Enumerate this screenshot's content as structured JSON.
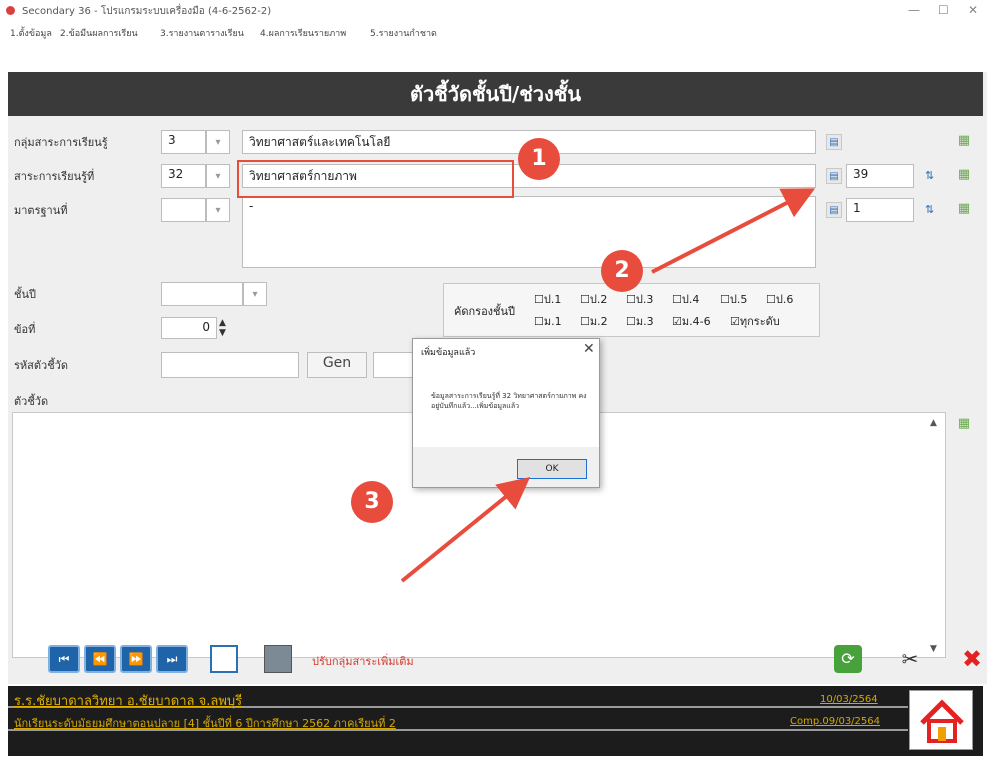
{
  "window": {
    "title": "Secondary 36 - โปรแกรมระบบเครื่องมือ (4-6-2562-2)"
  },
  "menu": [
    "1.ตั้งข้อมูล",
    "2.ข้อมืนผลการเรียน",
    "3.รายงานตารางเรียน",
    "4.ผลการเรียนรายภาพ",
    "5.รายงานกำชาด"
  ],
  "header": {
    "title": "ตัวชี้วัดชั้นปี/ช่วงชั้น"
  },
  "labels": {
    "subject_group": "กลุ่มสาระการเรียนรู้",
    "strand": "สาระการเรียนรู้ที่",
    "standard": "มาตรฐานที่",
    "grade": "ชั้นปี",
    "item_no": "ข้อที่",
    "indicator_code": "รหัสตัวชี้วัด",
    "indicator": "ตัวชี้วัด"
  },
  "fields": {
    "subject_group_code": "3",
    "subject_group_name": "วิทยาศาสตร์และเทคโนโลยี",
    "strand_code": "32",
    "strand_name": "วิทยาศาสตร์กายภาพ",
    "strand_count": "39",
    "standard_text": "-",
    "standard_count": "1",
    "item_value": "0",
    "gen_label": "Gen"
  },
  "grade_filter": {
    "label": "คัดกรองชั้นปี",
    "row1": [
      "ป.1",
      "ป.2",
      "ป.3",
      "ป.4",
      "ป.5",
      "ป.6"
    ],
    "row2": [
      {
        "text": "ม.1",
        "checked": false
      },
      {
        "text": "ม.2",
        "checked": false
      },
      {
        "text": "ม.3",
        "checked": false
      },
      {
        "text": "ม.4-6",
        "checked": true
      },
      {
        "text": "ทุกระดับ",
        "checked": true
      }
    ]
  },
  "dialog": {
    "title": "เพิ่มข้อมูลแล้ว",
    "message": "ข้อมูลสาระการเรียนรู้ที่ 32 วิทยาศาสตร์กายภาพ คงอยู่บันทึกแล้ว...เพิ่มข้อมูลแล้ว",
    "ok": "OK"
  },
  "toolbar": {
    "status_link": "ปรับกลุ่มสาระเพิ่มเติม"
  },
  "footer": {
    "school": "ร.ร.ชัยบาดาลวิทยา  อ.ชัยบาดาล  จ.ลพบุรี",
    "line2": "นักเรียนระดับมัธยมศึกษาตอนปลาย [4]  ชั้นปีที่ 6  ปีการศึกษา 2562  ภาคเรียนที่ 2",
    "date": "10/03/2564",
    "comp": "Comp.09/03/2564"
  },
  "callouts": [
    "1",
    "2",
    "3"
  ],
  "colors": {
    "header_bg": "#3a3a3a",
    "callout": "#e84c3d",
    "footer_text": "#d4a800"
  }
}
